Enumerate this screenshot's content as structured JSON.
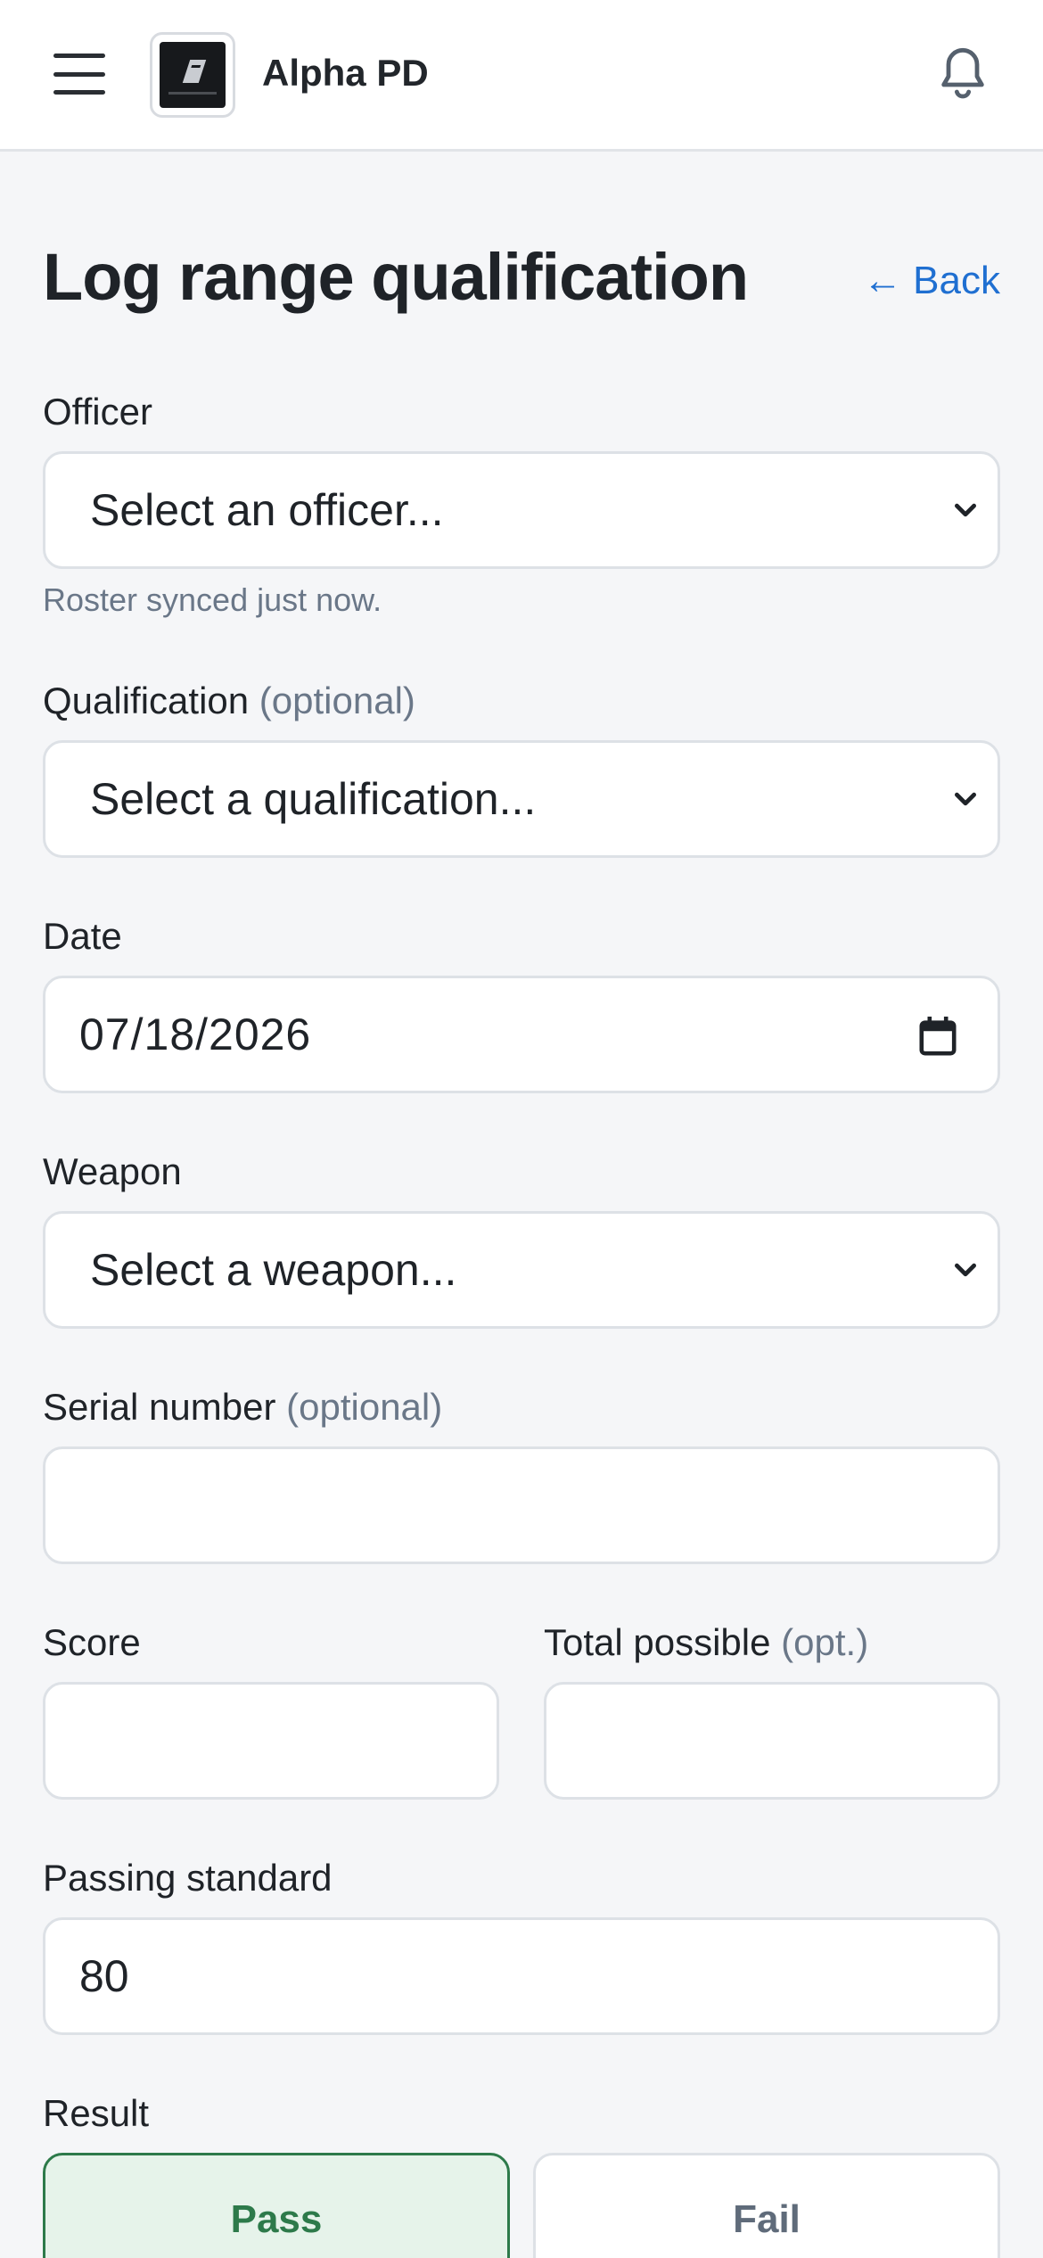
{
  "header": {
    "app_name": "Alpha PD"
  },
  "page": {
    "title": "Log range qualification",
    "back_label": "← Back"
  },
  "form": {
    "officer": {
      "label": "Officer",
      "value": "Select an officer...",
      "helper": "Roster synced just now."
    },
    "qualification": {
      "label": "Qualification",
      "optional": "(optional)",
      "value": "Select a qualification..."
    },
    "date": {
      "label": "Date",
      "value": "07/18/2026"
    },
    "weapon": {
      "label": "Weapon",
      "value": "Select a weapon..."
    },
    "serial": {
      "label": "Serial number",
      "optional": "(optional)",
      "value": ""
    },
    "score": {
      "label": "Score",
      "value": ""
    },
    "total": {
      "label": "Total possible",
      "optional": "(opt.)",
      "value": ""
    },
    "passing": {
      "label": "Passing standard",
      "value": "80"
    },
    "result": {
      "label": "Result",
      "pass_label": "Pass",
      "fail_label": "Fail",
      "selected": "Pass"
    }
  },
  "colors": {
    "accent_link": "#1f6fd1",
    "pass_green": "#2d7a4a",
    "pass_bg": "#e6f3ea",
    "muted": "#6a7788",
    "background": "#f5f6f8"
  },
  "icons": [
    "hamburger-menu-icon",
    "app-logo",
    "bell-icon",
    "chevron-down-icon",
    "calendar-icon"
  ]
}
